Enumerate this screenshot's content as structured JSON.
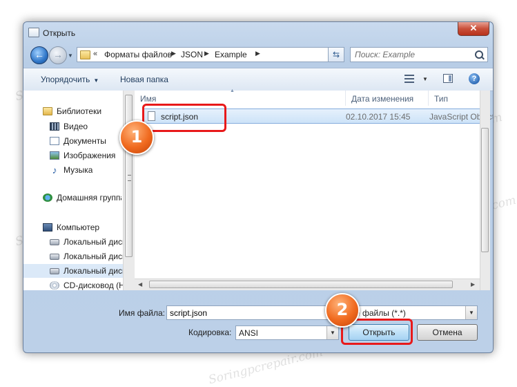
{
  "window": {
    "title": "Открыть"
  },
  "titlebar": {
    "close_glyph": "✕"
  },
  "nav": {
    "back_glyph": "←",
    "forward_glyph": "→",
    "path": [
      "Форматы файлов",
      "JSON",
      "Example"
    ],
    "path_prefix": "«",
    "search_placeholder": "Поиск: Example"
  },
  "toolbar": {
    "organize": "Упорядочить",
    "new_folder": "Новая папка",
    "help": "?"
  },
  "sidebar": {
    "items": [
      {
        "label": "Библиотеки",
        "icon": "library-icon"
      },
      {
        "label": "Видео",
        "icon": "video-icon"
      },
      {
        "label": "Документы",
        "icon": "documents-icon"
      },
      {
        "label": "Изображения",
        "icon": "images-icon"
      },
      {
        "label": "Музыка",
        "icon": "music-icon"
      },
      {
        "label": "Домашняя группа",
        "icon": "homegroup-icon"
      },
      {
        "label": "Компьютер",
        "icon": "computer-icon"
      },
      {
        "label": "Локальный диск (C:)",
        "icon": "drive-icon"
      },
      {
        "label": "Локальный диск (D:)",
        "icon": "drive-icon"
      },
      {
        "label": "Локальный диск (E:)",
        "icon": "drive-icon"
      },
      {
        "label": "CD-дисковод (H:)",
        "icon": "cd-drive-icon"
      }
    ]
  },
  "columns": {
    "name": "Имя",
    "date": "Дата изменения",
    "type": "Тип"
  },
  "files": [
    {
      "name": "script.json",
      "date": "02.10.2017 15:45",
      "type": "JavaScript Object ..."
    }
  ],
  "footer": {
    "filename_label": "Имя файла:",
    "filename_value": "script.json",
    "filetype_value": "Все файлы  (*.*)",
    "encoding_label": "Кодировка:",
    "encoding_value": "ANSI",
    "open_button": "Открыть",
    "cancel_button": "Отмена"
  },
  "annotations": {
    "badge_1": "1",
    "badge_2": "2"
  },
  "watermark": "Soringpcrepair.com",
  "colors": {
    "highlight_red": "#e8191a",
    "badge_orange": "#f06a1f",
    "selection_blue": "#cde3f8"
  }
}
